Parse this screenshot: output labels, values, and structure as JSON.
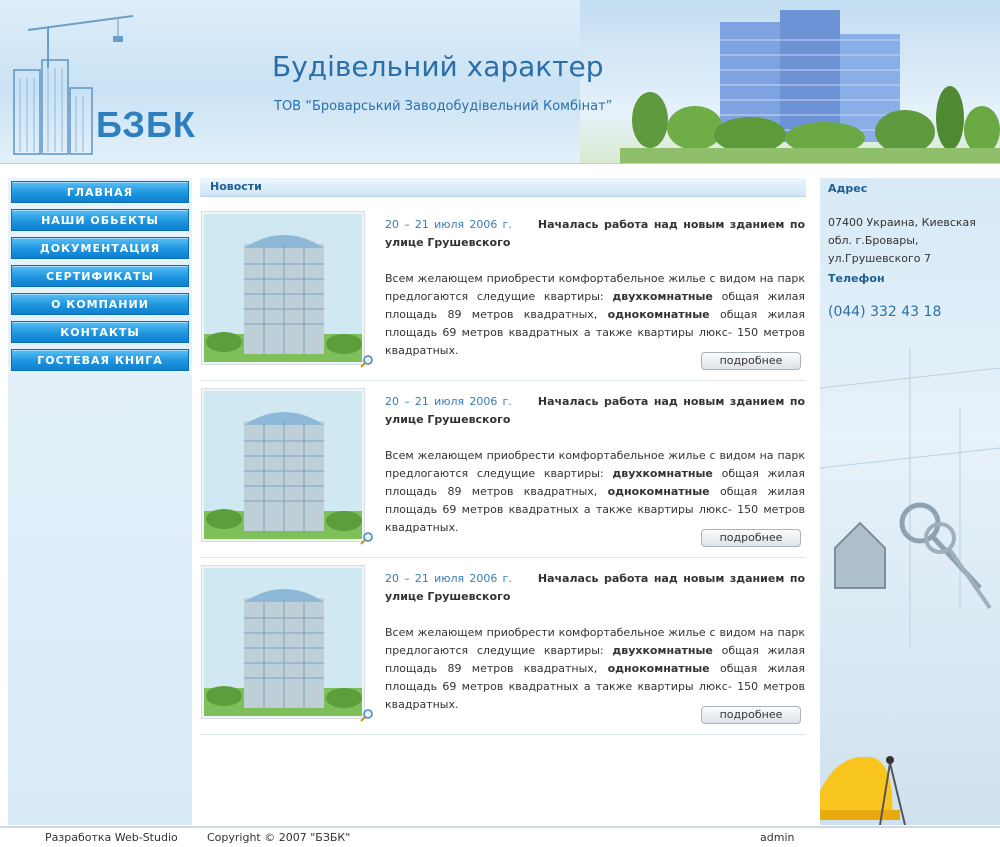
{
  "header": {
    "logo_text": "БЗБК",
    "title": "Будівельний характер",
    "subtitle": "ТОВ “Броварський Заводобудівельний Комбінат”"
  },
  "menu": [
    {
      "label": "ГЛАВНАЯ"
    },
    {
      "label": "НАШИ ОБЬЕКТЫ"
    },
    {
      "label": "ДОКУМЕНТАЦИЯ"
    },
    {
      "label": "СЕРТИФИКАТЫ"
    },
    {
      "label": "О КОМПАНИИ"
    },
    {
      "label": "КОНТАКТЫ"
    },
    {
      "label": "ГОСТЕВАЯ КНИГА"
    }
  ],
  "news": {
    "heading": "Новости",
    "items": [
      {
        "date": "20 – 21 июля 2006 г.",
        "title": "Началась работа над новым зданием по улице Грушевского",
        "body_1": "Всем желающем приобрести комфортабельное жилье с видом на парк предлогаются следущие квартиры: ",
        "strong_1": "двухкомнатные",
        "body_2": " общая жилая площадь 89 метров квадратных, ",
        "strong_2": "однокомнатные",
        "body_3": " общая жилая площадь 69 метров квадратных а также квартиры люкс- 150 метров квадратных.",
        "more": "подробнее"
      },
      {
        "date": "20 – 21 июля 2006 г.",
        "title": "Началась работа над новым зданием по улице Грушевского",
        "body_1": "Всем желающем приобрести комфортабельное жилье с видом на парк предлогаются следущие квартиры: ",
        "strong_1": "двухкомнатные",
        "body_2": " общая жилая площадь 89 метров квадратных, ",
        "strong_2": "однокомнатные",
        "body_3": " общая жилая площадь 69 метров квадратных а также квартиры люкс- 150 метров квадратных.",
        "more": "подробнее"
      },
      {
        "date": "20 – 21 июля 2006 г.",
        "title": "Началась работа над новым зданием по улице Грушевского",
        "body_1": "Всем желающем приобрести комфортабельное жилье с видом на парк предлогаются следущие квартиры: ",
        "strong_1": "двухкомнатные",
        "body_2": " общая жилая площадь 89 метров квадратных, ",
        "strong_2": "однокомнатные",
        "body_3": " общая жилая площадь 69 метров квадратных а также квартиры люкс- 150 метров квадратных.",
        "more": "подробнее"
      }
    ]
  },
  "contacts": {
    "address_label": "Адрес",
    "address": "07400 Украина, Киевская обл. г.Бровары, ул.Грушевского 7",
    "phone_label": "Телефон",
    "phone": "(044) 332 43 18"
  },
  "footer": {
    "dev": "Разработка Web-Studio",
    "copyright": "Copyright © 2007 \"БЗБК\"",
    "admin": "admin"
  },
  "icons": {
    "zoom": "magnifier-icon"
  },
  "colors": {
    "accent": "#2b6fa8",
    "menu": "#1e95de",
    "date": "#3a7bb4"
  }
}
